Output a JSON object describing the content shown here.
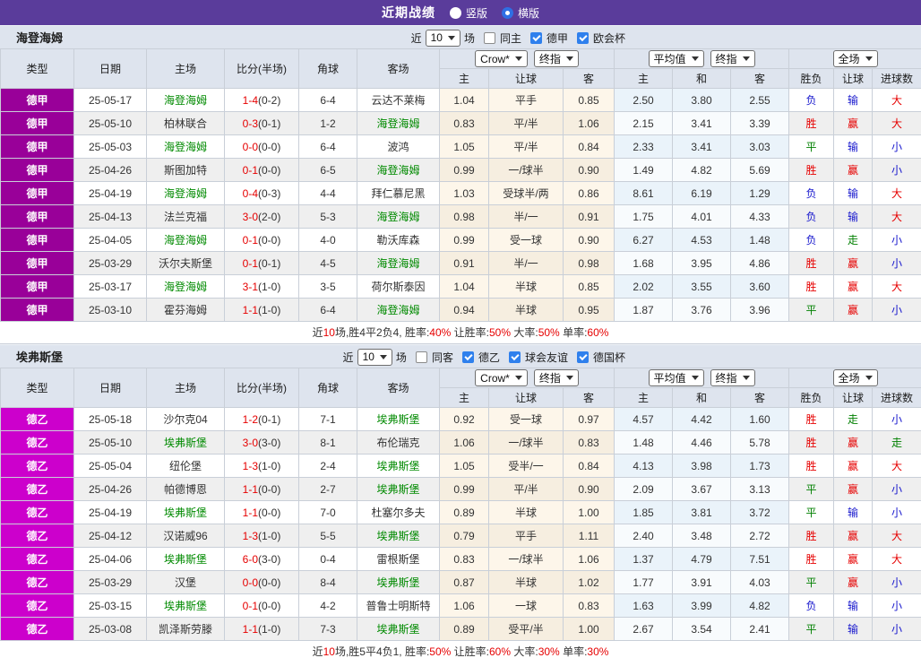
{
  "topbar": {
    "title": "近期战绩",
    "vertical": "竖版",
    "horizontal": "横版"
  },
  "colors": {
    "德甲": "#990099",
    "德乙": "#cc00cc",
    "accent_purple": "#5a3c9b",
    "focus_team_green": "#008a00",
    "win_red": "#e60000",
    "draw_green": "#008000",
    "lose_blue": "#1717cd"
  },
  "columns": {
    "type": "类型",
    "date": "日期",
    "home": "主场",
    "score": "比分(半场)",
    "corner": "角球",
    "away": "客场",
    "odds_home": "主",
    "handicap": "让球",
    "odds_away": "客",
    "avg_home": "主",
    "avg_draw": "和",
    "avg_away": "客",
    "result": "胜负",
    "handicap_result": "让球",
    "goals": "进球数"
  },
  "controls": {
    "bookmaker": "Crow*",
    "final": "终指",
    "average": "平均值",
    "fullmatch": "全场"
  },
  "sections": [
    {
      "team": "海登海姆",
      "filters": {
        "recent": "近",
        "n": "10",
        "games": "场",
        "same": {
          "label": "同主",
          "checked": false
        },
        "comps": [
          {
            "label": "德甲",
            "checked": true
          },
          {
            "label": "欧会杯",
            "checked": true
          }
        ]
      },
      "rows": [
        {
          "type": "德甲",
          "date": "25-05-17",
          "home": "海登海姆",
          "hf": 1,
          "score": "1-4",
          "half": "(0-2)",
          "corner": "6-4",
          "away": "云达不莱梅",
          "af": 0,
          "oh": "1.04",
          "ol": "平手",
          "oa": "0.85",
          "ah": "2.50",
          "ad": "3.80",
          "aa": "2.55",
          "res": [
            "负",
            "b"
          ],
          "hr": [
            "输",
            "b"
          ],
          "gr": [
            "大",
            "r"
          ]
        },
        {
          "type": "德甲",
          "date": "25-05-10",
          "home": "柏林联合",
          "hf": 0,
          "score": "0-3",
          "half": "(0-1)",
          "corner": "1-2",
          "away": "海登海姆",
          "af": 1,
          "oh": "0.83",
          "ol": "平/半",
          "oa": "1.06",
          "ah": "2.15",
          "ad": "3.41",
          "aa": "3.39",
          "res": [
            "胜",
            "r"
          ],
          "hr": [
            "赢",
            "r"
          ],
          "gr": [
            "大",
            "r"
          ]
        },
        {
          "type": "德甲",
          "date": "25-05-03",
          "home": "海登海姆",
          "hf": 1,
          "score": "0-0",
          "half": "(0-0)",
          "corner": "6-4",
          "away": "波鸿",
          "af": 0,
          "oh": "1.05",
          "ol": "平/半",
          "oa": "0.84",
          "ah": "2.33",
          "ad": "3.41",
          "aa": "3.03",
          "res": [
            "平",
            "g"
          ],
          "hr": [
            "输",
            "b"
          ],
          "gr": [
            "小",
            "b"
          ]
        },
        {
          "type": "德甲",
          "date": "25-04-26",
          "home": "斯图加特",
          "hf": 0,
          "score": "0-1",
          "half": "(0-0)",
          "corner": "6-5",
          "away": "海登海姆",
          "af": 1,
          "oh": "0.99",
          "ol": "一/球半",
          "oa": "0.90",
          "ah": "1.49",
          "ad": "4.82",
          "aa": "5.69",
          "res": [
            "胜",
            "r"
          ],
          "hr": [
            "赢",
            "r"
          ],
          "gr": [
            "小",
            "b"
          ]
        },
        {
          "type": "德甲",
          "date": "25-04-19",
          "home": "海登海姆",
          "hf": 1,
          "score": "0-4",
          "half": "(0-3)",
          "corner": "4-4",
          "away": "拜仁慕尼黑",
          "af": 0,
          "oh": "1.03",
          "ol": "受球半/两",
          "oa": "0.86",
          "ah": "8.61",
          "ad": "6.19",
          "aa": "1.29",
          "res": [
            "负",
            "b"
          ],
          "hr": [
            "输",
            "b"
          ],
          "gr": [
            "大",
            "r"
          ]
        },
        {
          "type": "德甲",
          "date": "25-04-13",
          "home": "法兰克福",
          "hf": 0,
          "score": "3-0",
          "half": "(2-0)",
          "corner": "5-3",
          "away": "海登海姆",
          "af": 1,
          "oh": "0.98",
          "ol": "半/一",
          "oa": "0.91",
          "ah": "1.75",
          "ad": "4.01",
          "aa": "4.33",
          "res": [
            "负",
            "b"
          ],
          "hr": [
            "输",
            "b"
          ],
          "gr": [
            "大",
            "r"
          ]
        },
        {
          "type": "德甲",
          "date": "25-04-05",
          "home": "海登海姆",
          "hf": 1,
          "score": "0-1",
          "half": "(0-0)",
          "corner": "4-0",
          "away": "勒沃库森",
          "af": 0,
          "oh": "0.99",
          "ol": "受一球",
          "oa": "0.90",
          "ah": "6.27",
          "ad": "4.53",
          "aa": "1.48",
          "res": [
            "负",
            "b"
          ],
          "hr": [
            "走",
            "g"
          ],
          "gr": [
            "小",
            "b"
          ]
        },
        {
          "type": "德甲",
          "date": "25-03-29",
          "home": "沃尔夫斯堡",
          "hf": 0,
          "score": "0-1",
          "half": "(0-1)",
          "corner": "4-5",
          "away": "海登海姆",
          "af": 1,
          "oh": "0.91",
          "ol": "半/一",
          "oa": "0.98",
          "ah": "1.68",
          "ad": "3.95",
          "aa": "4.86",
          "res": [
            "胜",
            "r"
          ],
          "hr": [
            "赢",
            "r"
          ],
          "gr": [
            "小",
            "b"
          ]
        },
        {
          "type": "德甲",
          "date": "25-03-17",
          "home": "海登海姆",
          "hf": 1,
          "score": "3-1",
          "half": "(1-0)",
          "corner": "3-5",
          "away": "荷尔斯泰因",
          "af": 0,
          "oh": "1.04",
          "ol": "半球",
          "oa": "0.85",
          "ah": "2.02",
          "ad": "3.55",
          "aa": "3.60",
          "res": [
            "胜",
            "r"
          ],
          "hr": [
            "赢",
            "r"
          ],
          "gr": [
            "大",
            "r"
          ]
        },
        {
          "type": "德甲",
          "date": "25-03-10",
          "home": "霍芬海姆",
          "hf": 0,
          "score": "1-1",
          "half": "(1-0)",
          "corner": "6-4",
          "away": "海登海姆",
          "af": 1,
          "oh": "0.94",
          "ol": "半球",
          "oa": "0.95",
          "ah": "1.87",
          "ad": "3.76",
          "aa": "3.96",
          "res": [
            "平",
            "g"
          ],
          "hr": [
            "赢",
            "r"
          ],
          "gr": [
            "小",
            "b"
          ]
        }
      ],
      "summary": [
        [
          "近",
          "k"
        ],
        [
          "10",
          "r"
        ],
        [
          "场,胜4平2负4, 胜率:",
          "k"
        ],
        [
          "40%",
          "r"
        ],
        [
          " 让胜率:",
          "k"
        ],
        [
          "50%",
          "r"
        ],
        [
          " 大率:",
          "k"
        ],
        [
          "50%",
          "r"
        ],
        [
          " 单率:",
          "k"
        ],
        [
          "60%",
          "r"
        ]
      ]
    },
    {
      "team": "埃弗斯堡",
      "filters": {
        "recent": "近",
        "n": "10",
        "games": "场",
        "same": {
          "label": "同客",
          "checked": false
        },
        "comps": [
          {
            "label": "德乙",
            "checked": true
          },
          {
            "label": "球会友谊",
            "checked": true
          },
          {
            "label": "德国杯",
            "checked": true
          }
        ]
      },
      "rows": [
        {
          "type": "德乙",
          "date": "25-05-18",
          "home": "沙尔克04",
          "hf": 0,
          "score": "1-2",
          "half": "(0-1)",
          "corner": "7-1",
          "away": "埃弗斯堡",
          "af": 1,
          "oh": "0.92",
          "ol": "受一球",
          "oa": "0.97",
          "ah": "4.57",
          "ad": "4.42",
          "aa": "1.60",
          "res": [
            "胜",
            "r"
          ],
          "hr": [
            "走",
            "g"
          ],
          "gr": [
            "小",
            "b"
          ]
        },
        {
          "type": "德乙",
          "date": "25-05-10",
          "home": "埃弗斯堡",
          "hf": 1,
          "score": "3-0",
          "half": "(3-0)",
          "corner": "8-1",
          "away": "布伦瑞克",
          "af": 0,
          "oh": "1.06",
          "ol": "一/球半",
          "oa": "0.83",
          "ah": "1.48",
          "ad": "4.46",
          "aa": "5.78",
          "res": [
            "胜",
            "r"
          ],
          "hr": [
            "赢",
            "r"
          ],
          "gr": [
            "走",
            "g"
          ]
        },
        {
          "type": "德乙",
          "date": "25-05-04",
          "home": "纽伦堡",
          "hf": 0,
          "score": "1-3",
          "half": "(1-0)",
          "corner": "2-4",
          "away": "埃弗斯堡",
          "af": 1,
          "oh": "1.05",
          "ol": "受半/一",
          "oa": "0.84",
          "ah": "4.13",
          "ad": "3.98",
          "aa": "1.73",
          "res": [
            "胜",
            "r"
          ],
          "hr": [
            "赢",
            "r"
          ],
          "gr": [
            "大",
            "r"
          ]
        },
        {
          "type": "德乙",
          "date": "25-04-26",
          "home": "帕德博恩",
          "hf": 0,
          "score": "1-1",
          "half": "(0-0)",
          "corner": "2-7",
          "away": "埃弗斯堡",
          "af": 1,
          "oh": "0.99",
          "ol": "平/半",
          "oa": "0.90",
          "ah": "2.09",
          "ad": "3.67",
          "aa": "3.13",
          "res": [
            "平",
            "g"
          ],
          "hr": [
            "赢",
            "r"
          ],
          "gr": [
            "小",
            "b"
          ]
        },
        {
          "type": "德乙",
          "date": "25-04-19",
          "home": "埃弗斯堡",
          "hf": 1,
          "score": "1-1",
          "half": "(0-0)",
          "corner": "7-0",
          "away": "杜塞尔多夫",
          "af": 0,
          "oh": "0.89",
          "ol": "半球",
          "oa": "1.00",
          "ah": "1.85",
          "ad": "3.81",
          "aa": "3.72",
          "res": [
            "平",
            "g"
          ],
          "hr": [
            "输",
            "b"
          ],
          "gr": [
            "小",
            "b"
          ]
        },
        {
          "type": "德乙",
          "date": "25-04-12",
          "home": "汉诺威96",
          "hf": 0,
          "score": "1-3",
          "half": "(1-0)",
          "corner": "5-5",
          "away": "埃弗斯堡",
          "af": 1,
          "oh": "0.79",
          "ol": "平手",
          "oa": "1.11",
          "ah": "2.40",
          "ad": "3.48",
          "aa": "2.72",
          "res": [
            "胜",
            "r"
          ],
          "hr": [
            "赢",
            "r"
          ],
          "gr": [
            "大",
            "r"
          ]
        },
        {
          "type": "德乙",
          "date": "25-04-06",
          "home": "埃弗斯堡",
          "hf": 1,
          "score": "6-0",
          "half": "(3-0)",
          "corner": "0-4",
          "away": "雷根斯堡",
          "af": 0,
          "oh": "0.83",
          "ol": "一/球半",
          "oa": "1.06",
          "ah": "1.37",
          "ad": "4.79",
          "aa": "7.51",
          "res": [
            "胜",
            "r"
          ],
          "hr": [
            "赢",
            "r"
          ],
          "gr": [
            "大",
            "r"
          ]
        },
        {
          "type": "德乙",
          "date": "25-03-29",
          "home": "汉堡",
          "hf": 0,
          "score": "0-0",
          "half": "(0-0)",
          "corner": "8-4",
          "away": "埃弗斯堡",
          "af": 1,
          "oh": "0.87",
          "ol": "半球",
          "oa": "1.02",
          "ah": "1.77",
          "ad": "3.91",
          "aa": "4.03",
          "res": [
            "平",
            "g"
          ],
          "hr": [
            "赢",
            "r"
          ],
          "gr": [
            "小",
            "b"
          ]
        },
        {
          "type": "德乙",
          "date": "25-03-15",
          "home": "埃弗斯堡",
          "hf": 1,
          "score": "0-1",
          "half": "(0-0)",
          "corner": "4-2",
          "away": "普鲁士明斯特",
          "af": 0,
          "oh": "1.06",
          "ol": "一球",
          "oa": "0.83",
          "ah": "1.63",
          "ad": "3.99",
          "aa": "4.82",
          "res": [
            "负",
            "b"
          ],
          "hr": [
            "输",
            "b"
          ],
          "gr": [
            "小",
            "b"
          ]
        },
        {
          "type": "德乙",
          "date": "25-03-08",
          "home": "凯泽斯劳滕",
          "hf": 0,
          "score": "1-1",
          "half": "(1-0)",
          "corner": "7-3",
          "away": "埃弗斯堡",
          "af": 1,
          "oh": "0.89",
          "ol": "受平/半",
          "oa": "1.00",
          "ah": "2.67",
          "ad": "3.54",
          "aa": "2.41",
          "res": [
            "平",
            "g"
          ],
          "hr": [
            "输",
            "b"
          ],
          "gr": [
            "小",
            "b"
          ]
        }
      ],
      "summary": [
        [
          "近",
          "k"
        ],
        [
          "10",
          "r"
        ],
        [
          "场,胜5平4负1, 胜率:",
          "k"
        ],
        [
          "50%",
          "r"
        ],
        [
          " 让胜率:",
          "k"
        ],
        [
          "60%",
          "r"
        ],
        [
          " 大率:",
          "k"
        ],
        [
          "30%",
          "r"
        ],
        [
          " 单率:",
          "k"
        ],
        [
          "30%",
          "r"
        ]
      ]
    }
  ]
}
